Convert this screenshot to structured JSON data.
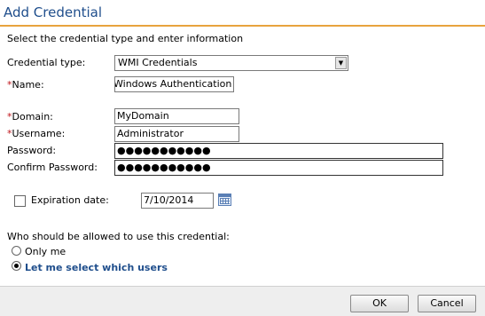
{
  "dialog": {
    "title": "Add Credential",
    "instruction": "Select the credential type and enter information"
  },
  "form": {
    "credential_type": {
      "label": "Credential type:",
      "value": "WMI Credentials"
    },
    "name": {
      "required_mark": "*",
      "label": "Name:",
      "value": "Windows Authentication"
    },
    "domain": {
      "required_mark": "*",
      "label": "Domain:",
      "value": "MyDomain"
    },
    "username": {
      "required_mark": "*",
      "label": "Username:",
      "value": "Administrator"
    },
    "password": {
      "label": "Password:",
      "value": "●●●●●●●●●●●"
    },
    "confirm_password": {
      "label": "Confirm Password:",
      "value": "●●●●●●●●●●●"
    },
    "expiration": {
      "label": "Expiration date:",
      "value": "7/10/2014",
      "checked": false
    }
  },
  "access": {
    "question": "Who should be allowed to use this credential:",
    "options": [
      {
        "label": "Only me",
        "selected": false
      },
      {
        "label": "Let me select which users",
        "selected": true
      }
    ]
  },
  "footer": {
    "ok_label": "OK",
    "cancel_label": "Cancel"
  },
  "colors": {
    "title": "#1f4e8c",
    "accent_line": "#e8a33d",
    "required": "#c0161c"
  },
  "icons": {
    "dropdown": "chevron-down-icon",
    "calendar": "calendar-icon"
  }
}
